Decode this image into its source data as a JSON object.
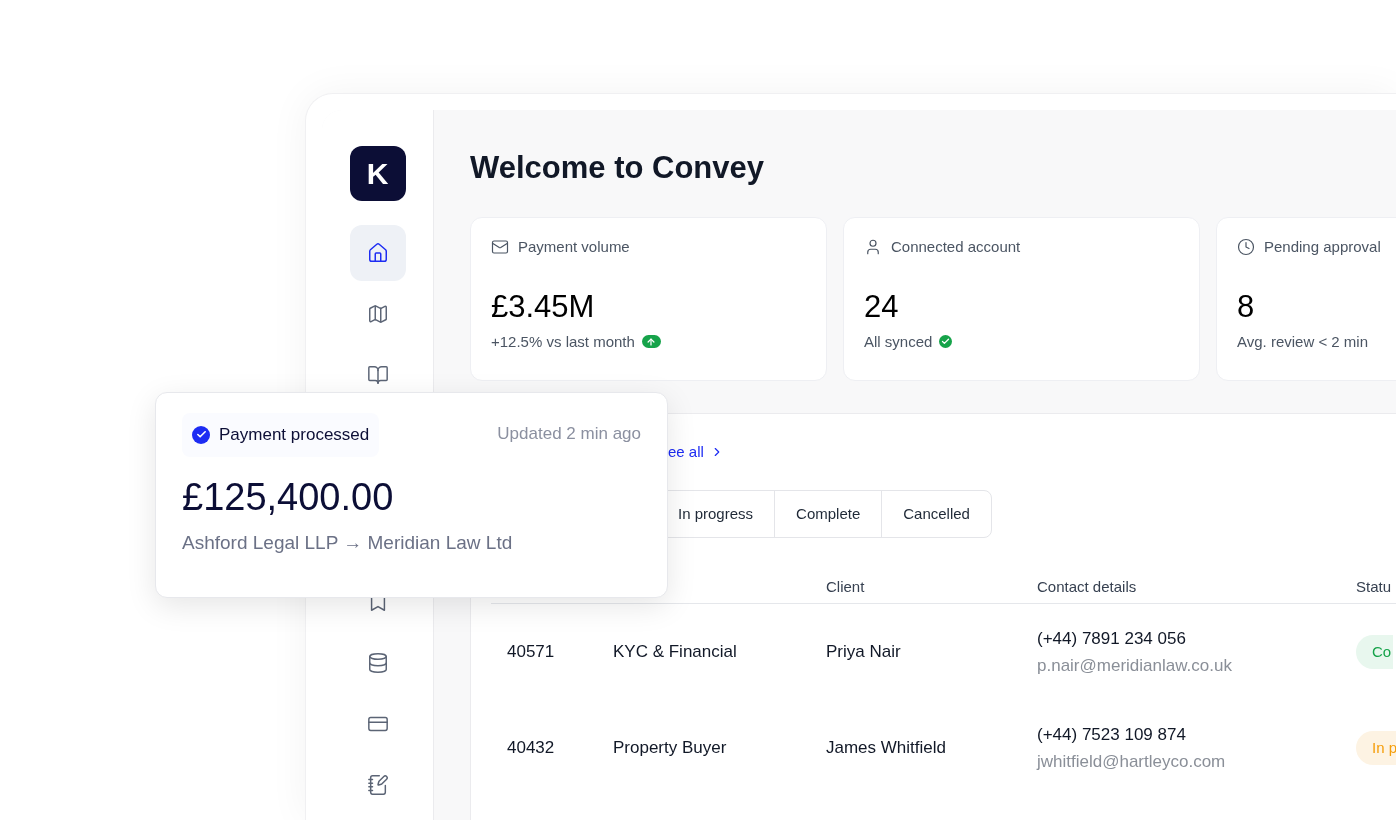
{
  "sidebar": {
    "logo": "K",
    "nav_top": [
      {
        "selected": true
      },
      {
        "selected": false
      },
      {
        "selected": false
      }
    ],
    "nav_bottom": [
      {
        "selected": false
      },
      {
        "selected": false
      },
      {
        "selected": false
      },
      {
        "selected": false
      }
    ]
  },
  "title": "Welcome to Convey",
  "stats": [
    {
      "label": "Payment volume",
      "value": "£3.45M",
      "note": "+12.5% vs last month",
      "kind": "trend_up"
    },
    {
      "label": "Connected account",
      "value": "24",
      "note": "All synced",
      "kind": "synced"
    },
    {
      "label": "Pending approval",
      "value": "8",
      "note": "Avg. review < 2 min",
      "kind": "plain"
    }
  ],
  "see_all": "ee all",
  "tabs": [
    {
      "label": "In progress",
      "selected": false
    },
    {
      "label": "Complete",
      "selected": false
    },
    {
      "label": "Cancelled",
      "selected": false
    }
  ],
  "table": {
    "columns": [
      "Client",
      "Contact details",
      "Statu"
    ],
    "rows": [
      {
        "id": "40571",
        "type": "KYC & Financial",
        "client": "Priya Nair",
        "phone": "(+44) 7891 234 056",
        "email": "p.nair@meridianlaw.co.uk",
        "status": {
          "label": "Co",
          "kind": "complete"
        }
      },
      {
        "id": "40432",
        "type": "Property Buyer",
        "client": "James Whitfield",
        "phone": "(+44) 7523 109 874",
        "email": "jwhitfield@hartleyco.com",
        "status": {
          "label": "In p",
          "kind": "in_progress"
        }
      }
    ]
  },
  "toast": {
    "badge": "Payment processed",
    "time": "Updated 2 min ago",
    "amount": "£125,400.00",
    "route": "Ashford Legal LLP → Meridian Law Ltd"
  }
}
